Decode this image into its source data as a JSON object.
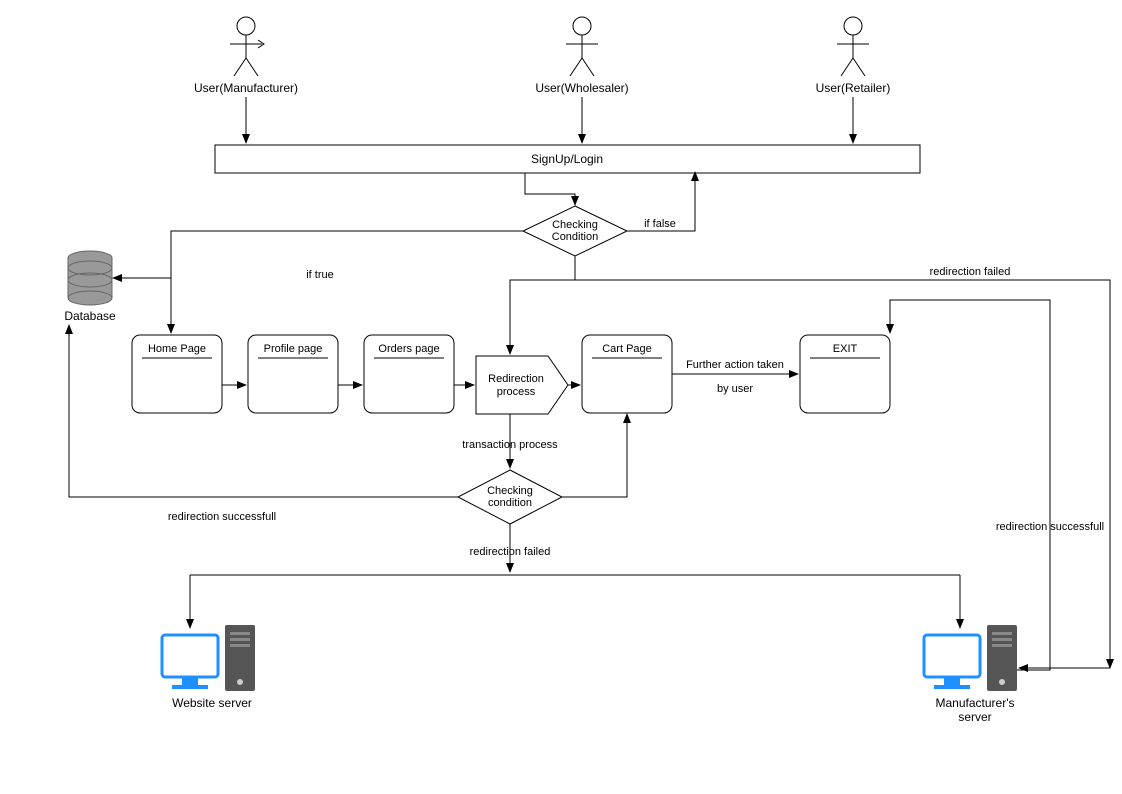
{
  "actors": {
    "manufacturer": "User(Manufacturer)",
    "wholesaler": "User(Wholesaler)",
    "retailer": "User(Retailer)"
  },
  "nodes": {
    "signup": "SignUp/Login",
    "check1_l1": "Checking",
    "check1_l2": "Condition",
    "database": "Database",
    "home": "Home Page",
    "profile": "Profile page",
    "orders": "Orders page",
    "redir_l1": "Redirection",
    "redir_l2": "process",
    "cart": "Cart Page",
    "exit": "EXIT",
    "check2_l1": "Checking",
    "check2_l2": "condition",
    "website_server": "Website server",
    "manuf_server_l1": "Manufacturer's",
    "manuf_server_l2": "server"
  },
  "edges": {
    "if_false": "if false",
    "if_true": "if true",
    "redir_failed_top": "redirection failed",
    "transaction": "transaction process",
    "further_l1": "Further action taken",
    "further_l2": "by user",
    "redir_success_left": "redirection successfull",
    "redir_failed_mid": "redirection failed",
    "redir_success_right": "redirection successfull"
  }
}
